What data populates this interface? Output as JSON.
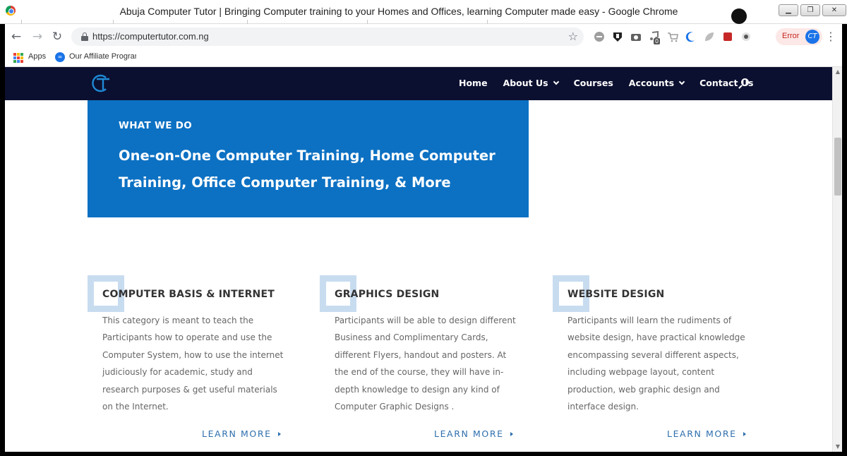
{
  "window": {
    "title": "Abuja Computer Tutor | Bringing Computer training to your Homes and Offices, learning Computer made easy - Google Chrome",
    "controls": {
      "minimize": "▁",
      "maximize": "❐",
      "close": "✕"
    }
  },
  "browser": {
    "url": "https://computertutor.com.ng",
    "error_label": "Error",
    "extension_badge": "0",
    "bookmarks": [
      {
        "label": "Apps",
        "icon": "apps-grid-icon"
      },
      {
        "label": "Our Affiliate Program",
        "icon": "affiliate-icon"
      }
    ]
  },
  "site": {
    "nav": {
      "items": [
        {
          "label": "Home",
          "has_dropdown": false
        },
        {
          "label": "About Us",
          "has_dropdown": true
        },
        {
          "label": "Courses",
          "has_dropdown": false
        },
        {
          "label": "Accounts",
          "has_dropdown": true
        },
        {
          "label": "Contact Us",
          "has_dropdown": false
        }
      ]
    },
    "hero": {
      "eyebrow": "WHAT WE DO",
      "title": "One-on-One Computer Training, Home Computer Training, Office Computer Training, & More"
    },
    "services": [
      {
        "title": "COMPUTER BASIS & INTERNET",
        "description": "This category is meant to teach the Participants how to operate and use the Computer System, how to use the internet judiciously for academic, study and research purposes & get useful materials on the Internet.",
        "link": "LEARN MORE"
      },
      {
        "title": "GRAPHICS DESIGN",
        "description": "Participants will be able to design different Business and Complimentary Cards, different Flyers, handout and posters. At the end of the course, they will have in-depth knowledge to design any kind of Computer Graphic Designs .",
        "link": "LEARN MORE"
      },
      {
        "title": "WEBSITE DESIGN",
        "description": "Participants will learn the rudiments of website design, have practical knowledge encompassing several different aspects, including webpage layout, content production, web graphic design and interface design.",
        "link": "LEARN MORE"
      }
    ]
  },
  "colors": {
    "header_bg": "#0c1030",
    "hero_bg": "#0c71c3",
    "accent_marker": "#c8dcf0",
    "link": "#2e6fad",
    "body_text": "#666666",
    "heading_text": "#333333"
  }
}
